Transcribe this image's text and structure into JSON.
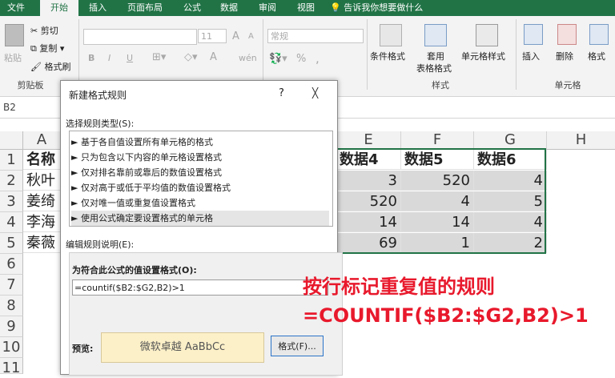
{
  "tabs": [
    "文件",
    "开始",
    "插入",
    "页面布局",
    "公式",
    "数据",
    "审阅",
    "视图"
  ],
  "tell_me": "告诉我你想要做什么",
  "clipboard": {
    "paste": "粘贴",
    "cut": "剪切",
    "copy": "复制",
    "painter": "格式刷",
    "group": "剪贴板"
  },
  "font": {
    "size": "11",
    "bold": "B",
    "italic": "I",
    "underline": "U",
    "grow": "A",
    "shrink": "A",
    "font_color": "A",
    "phonetic": "wén"
  },
  "number": {
    "format": "常规",
    "percent": "%",
    "comma": ","
  },
  "styles": {
    "cond_format": "条件格式",
    "table_format": "套用",
    "table_format2": "表格格式",
    "cell_style": "单元格样式",
    "group": "样式"
  },
  "cells": {
    "insert": "插入",
    "delete": "删除",
    "format": "格式",
    "group": "单元格"
  },
  "namebox": "B2",
  "columns": [
    "A",
    "E",
    "F",
    "G",
    "H"
  ],
  "rows": [
    "1",
    "2",
    "3",
    "4",
    "5",
    "6",
    "7",
    "8",
    "9",
    "10",
    "11"
  ],
  "grid": {
    "a_col": [
      "名称",
      "秋叶",
      "姜绮",
      "李海",
      "秦薇"
    ],
    "e_col": [
      "数据4",
      "3",
      "520",
      "14",
      "69"
    ],
    "f_col": [
      "数据5",
      "520",
      "4",
      "14",
      "1"
    ],
    "g_col": [
      "数据6",
      "4",
      "5",
      "4",
      "2"
    ]
  },
  "dialog": {
    "title": "新建格式规则",
    "help": "?",
    "close": "╳",
    "select_type_label": "选择规则类型(S):",
    "rules": [
      "► 基于各自值设置所有单元格的格式",
      "► 只为包含以下内容的单元格设置格式",
      "► 仅对排名靠前或靠后的数值设置格式",
      "► 仅对高于或低于平均值的数值设置格式",
      "► 仅对唯一值或重复值设置格式",
      "► 使用公式确定要设置格式的单元格"
    ],
    "edit_desc_label": "编辑规则说明(E):",
    "formula_label": "为符合此公式的值设置格式(O):",
    "formula_value": "=countif($B2:$G2,B2)>1",
    "preview_label": "预览:",
    "preview_text": "微软卓越  AaBbCc",
    "format_button": "格式(F)..."
  },
  "annotation": {
    "line1": "按行标记重复值的规则",
    "line2": "=COUNTIF($B2:$G2,B2)>1"
  },
  "colors": {
    "excel_green": "#217346",
    "selection": "#d9d9d9",
    "preview_bg": "#fcf0c8",
    "annotation": "#e8192c"
  }
}
